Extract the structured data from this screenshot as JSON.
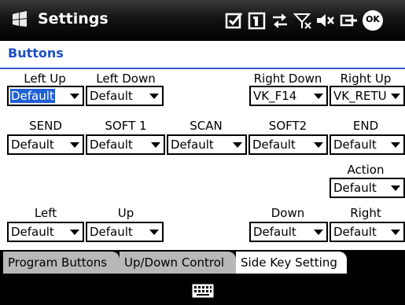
{
  "titlebar": {
    "title": "Settings",
    "ok_label": "OK",
    "icons": [
      "windows-start-icon",
      "checkbox-icon",
      "sim-icon",
      "sync-arrows-icon",
      "no-signal-icon",
      "speaker-muted-icon",
      "battery-plug-icon",
      "ok-icon"
    ]
  },
  "section_title": "Buttons",
  "rows": {
    "row1": {
      "labels": [
        "Left Up",
        "Left Down",
        "Right Down",
        "Right Up"
      ],
      "values": [
        "Default",
        "Default",
        "VK_F14",
        "VK_RETU"
      ]
    },
    "row2": {
      "labels": [
        "SEND",
        "SOFT 1",
        "SCAN",
        "SOFT2",
        "END"
      ],
      "values": [
        "Default",
        "Default",
        "Default",
        "Default",
        "Default"
      ]
    },
    "row3": {
      "labels": [
        "Action"
      ],
      "values": [
        "Default"
      ]
    },
    "row4": {
      "labels": [
        "Left",
        "Up",
        "Down",
        "Right"
      ],
      "values": [
        "Default",
        "Default",
        "Default",
        "Default"
      ]
    }
  },
  "tabs": [
    "Program Buttons",
    "Up/Down Control",
    "Side Key Setting"
  ],
  "active_tab": "Side Key Setting",
  "colors": {
    "accent": "#1e4fc9",
    "selection": "#1f5fd6",
    "titlebar": "#141414",
    "tab_inactive": "#b8b8b8"
  }
}
